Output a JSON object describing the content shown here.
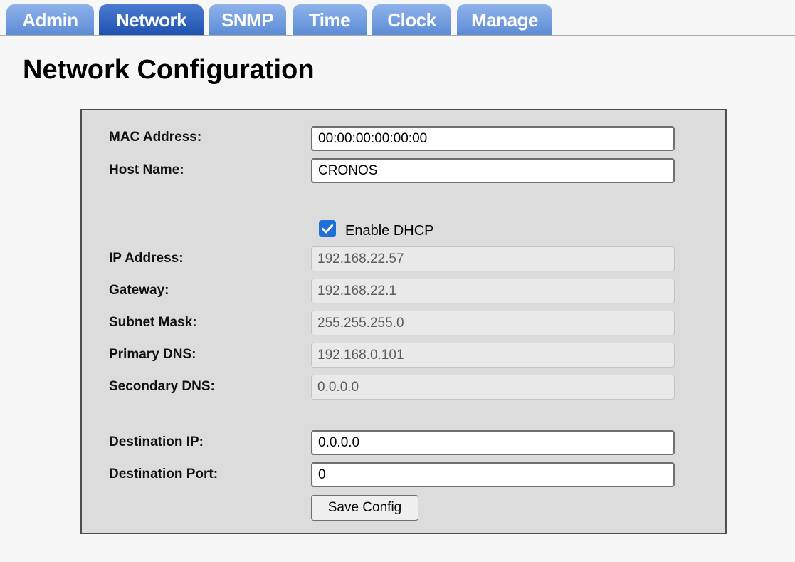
{
  "tabs": [
    {
      "label": "Admin",
      "active": false
    },
    {
      "label": "Network",
      "active": true
    },
    {
      "label": "SNMP",
      "active": false
    },
    {
      "label": "Time",
      "active": false
    },
    {
      "label": "Clock",
      "active": false
    },
    {
      "label": "Manage",
      "active": false
    }
  ],
  "page": {
    "title": "Network Configuration"
  },
  "form": {
    "mac_address": {
      "label": "MAC Address:",
      "value": "00:00:00:00:00:00"
    },
    "host_name": {
      "label": "Host Name:",
      "value": "CRONOS"
    },
    "dhcp": {
      "label": "Enable DHCP",
      "checked": true
    },
    "ip_address": {
      "label": "IP Address:",
      "value": "192.168.22.57"
    },
    "gateway": {
      "label": "Gateway:",
      "value": "192.168.22.1"
    },
    "subnet_mask": {
      "label": "Subnet Mask:",
      "value": "255.255.255.0"
    },
    "primary_dns": {
      "label": "Primary DNS:",
      "value": "192.168.0.101"
    },
    "secondary_dns": {
      "label": "Secondary DNS:",
      "value": "0.0.0.0"
    },
    "destination_ip": {
      "label": "Destination IP:",
      "value": "0.0.0.0"
    },
    "destination_port": {
      "label": "Destination Port:",
      "value": "0"
    },
    "save_label": "Save Config"
  },
  "colors": {
    "tab_active": "#1f52b0",
    "tab_inactive": "#5b8bd6",
    "panel_background": "#dcdcdc",
    "checkbox_accent": "#1f6fd8"
  }
}
